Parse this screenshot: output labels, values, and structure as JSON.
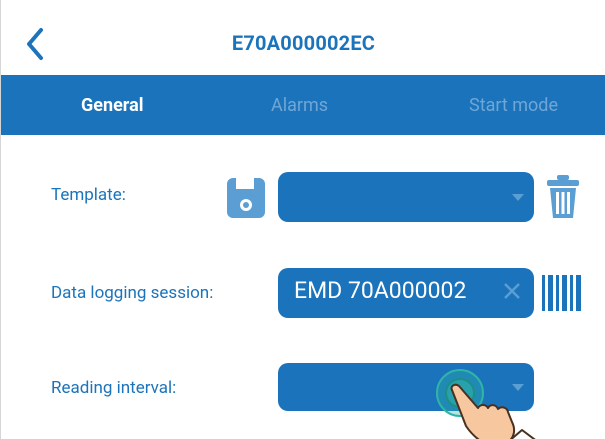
{
  "header": {
    "title": "E70A000002EC",
    "back_icon": "chevron-left-icon"
  },
  "tabs": [
    {
      "label": "General",
      "active": true
    },
    {
      "label": "Alarms",
      "active": false
    },
    {
      "label": "Start mode",
      "active": false
    }
  ],
  "form": {
    "template": {
      "label": "Template:",
      "value": "",
      "save_icon": "floppy-save-icon",
      "delete_icon": "trash-icon"
    },
    "data_logging_session": {
      "label": "Data logging session:",
      "value": "EMD 70A000002",
      "clear_icon": "close-icon",
      "barcode_icon": "barcode-icon"
    },
    "reading_interval": {
      "label": "Reading interval:",
      "value": ""
    }
  },
  "colors": {
    "primary": "#1b74bb",
    "tab_inactive_text": "#6fa6d6",
    "accent_light": "#5b9ed4",
    "tap_highlight": "#2fb4a8"
  }
}
